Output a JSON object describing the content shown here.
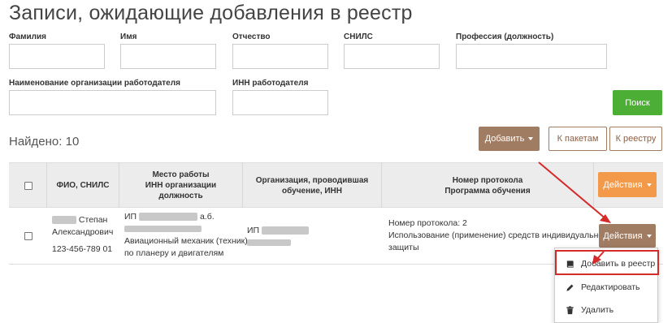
{
  "page": {
    "title": "Записи, ожидающие добавления в реестр"
  },
  "filters": {
    "last_name_label": "Фамилия",
    "first_name_label": "Имя",
    "middle_name_label": "Отчество",
    "snils_label": "СНИЛС",
    "profession_label": "Профессия (должность)",
    "employer_label": "Наименование организации работодателя",
    "employer_inn_label": "ИНН работодателя",
    "last_name_value": "",
    "first_name_value": "",
    "middle_name_value": "",
    "snils_value": "",
    "profession_value": "",
    "employer_value": "",
    "employer_inn_value": "",
    "search_button": "Поиск"
  },
  "results": {
    "found_text": "Найдено: 10",
    "add_button": "Добавить",
    "to_packages_button": "К пакетам",
    "to_registry_button": "К реестру"
  },
  "table": {
    "headers": {
      "fio": "ФИО, СНИЛС",
      "workplace_line1": "Место работы",
      "workplace_line2": "ИНН организации",
      "workplace_line3": "должность",
      "training_org_line1": "Организация, проводившая",
      "training_org_line2": "обучение, ИНН",
      "protocol_line1": "Номер протокола",
      "protocol_line2": "Программа обучения",
      "actions": "Действия"
    },
    "rows": [
      {
        "name_line1": "Степан",
        "name_line2": "Александрович",
        "snils": "123-456-789 01",
        "workplace_prefix": "ИП",
        "workplace_suffix": "а.б.",
        "position_line1": "Авиационный механик (техник)",
        "position_line2": "по планеру и двигателям",
        "training_org_prefix": "ИП",
        "protocol_number": "Номер протокола: 2",
        "program_line1": "Использование (применение) средств индивидуальной",
        "program_line2": "защиты",
        "actions": "Действия"
      }
    ]
  },
  "dropdown": {
    "add_to_registry": "Добавить в реестр",
    "edit": "Редактировать",
    "delete": "Удалить"
  },
  "colors": {
    "search_green": "#4cae35",
    "brown": "#a07c62",
    "orange": "#f39a4a",
    "highlight_red": "#d42a2a",
    "header_bg": "#ececec"
  }
}
